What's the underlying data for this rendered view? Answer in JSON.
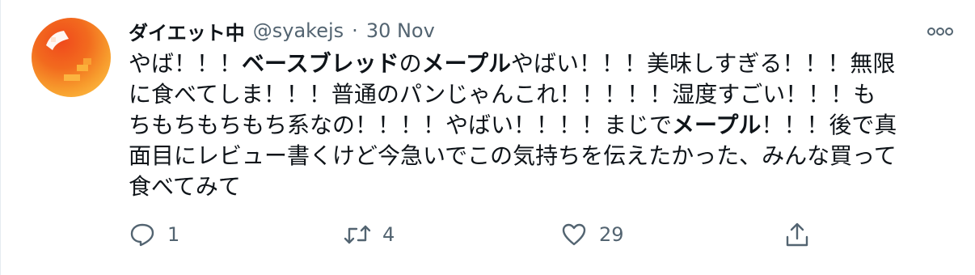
{
  "tweet": {
    "display_name": "ダイエット中",
    "handle": "@syakejs",
    "separator": "·",
    "date": "30 Nov",
    "text_lines": [
      [
        {
          "t": "やば！！！",
          "b": false
        },
        {
          "t": "ベースブレッド",
          "b": true
        },
        {
          "t": "の",
          "b": false
        },
        {
          "t": "メープル",
          "b": true
        },
        {
          "t": "やばい！！！美味しすぎる！！！無限",
          "b": false
        }
      ],
      [
        {
          "t": "に食べてしま！！！普通のパンじゃんこれ！！！！！湿度すごい！！！も",
          "b": false
        }
      ],
      [
        {
          "t": "ちもちもちもち系なの！！！！やばい！！！！まじで",
          "b": false
        },
        {
          "t": "メープル",
          "b": true
        },
        {
          "t": "！！！後で真",
          "b": false
        }
      ],
      [
        {
          "t": "面目にレビュー書くけど今急いでこの気持ちを伝えたかった、みんな買って",
          "b": false
        }
      ],
      [
        {
          "t": "食べてみて",
          "b": false
        }
      ]
    ]
  },
  "actions": {
    "reply_count": "1",
    "retweet_count": "4",
    "like_count": "29"
  },
  "icons": {
    "more": "more-horizontal-icon",
    "reply": "reply-bubble-icon",
    "retweet": "retweet-icon",
    "like": "heart-icon",
    "share": "share-upload-icon"
  },
  "colors": {
    "text": "#0f1419",
    "secondary": "#536471",
    "avatar_orange": "#f58a1f",
    "avatar_red": "#e0441c"
  }
}
